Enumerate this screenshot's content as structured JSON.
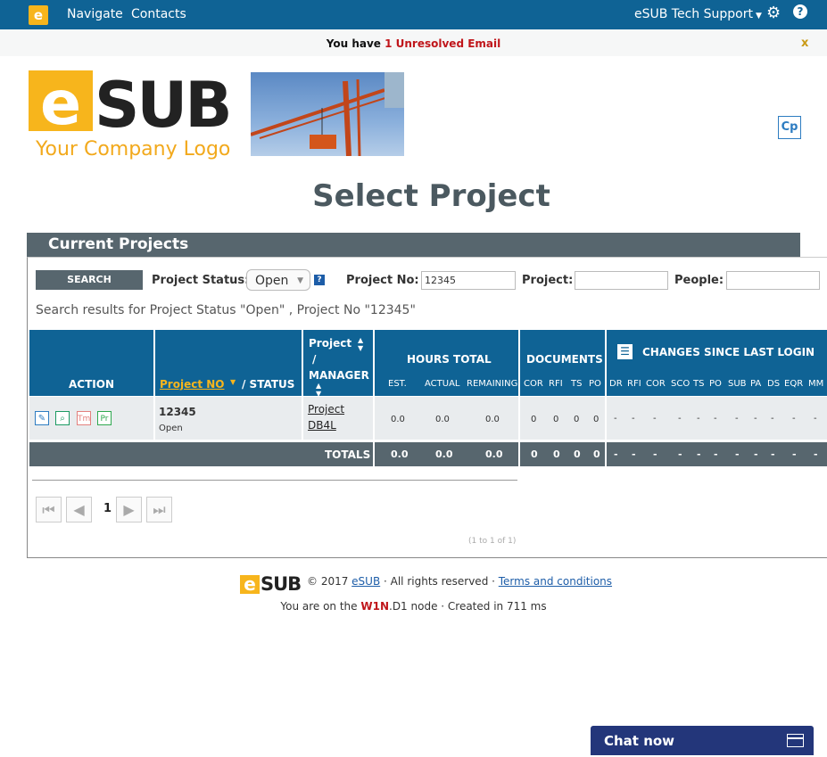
{
  "topbar": {
    "logo_letter": "e",
    "nav": "Navigate",
    "contacts": "Contacts",
    "user": "eSUB Tech Support",
    "help": "?"
  },
  "notice": {
    "prefix": "You have ",
    "count_text": "1 Unresolved Email",
    "close": "x"
  },
  "brand": {
    "logo_text_e": "e",
    "logo_text_sub": "SUB",
    "tagline": "Your Company Logo"
  },
  "cp_label": "Cp",
  "title": "Select Project",
  "panel_title": "Current Projects",
  "search": {
    "button": "SEARCH",
    "status_label": "Project Status:",
    "status_value": "Open",
    "help": "?",
    "project_no_label": "Project No:",
    "project_no_value": "12345",
    "project_label": "Project:",
    "people_label": "People:"
  },
  "results_text": "Search results for Project Status \"Open\" , Project No \"12345\"",
  "grid": {
    "action": "ACTION",
    "project_no": "Project NO",
    "status": "/ STATUS",
    "project": "Project",
    "slash": "/",
    "manager": "MANAGER",
    "hours_total": "HOURS TOTAL",
    "est": "EST.",
    "actual": "ACTUAL",
    "remaining": "REMAINING",
    "documents": "DOCUMENTS",
    "doc_cols": [
      "COR",
      "RFI",
      "TS",
      "PO"
    ],
    "changes": "CHANGES SINCE LAST LOGIN",
    "change_cols": [
      "DR",
      "RFI",
      "COR",
      "SCO",
      "TS",
      "PO",
      "SUB",
      "PA",
      "DS",
      "EQR",
      "MM"
    ]
  },
  "row": {
    "actions": [
      "✎",
      "⌕",
      "Tm",
      "Pr"
    ],
    "number": "12345",
    "status": "Open",
    "project_name_1": "Project",
    "project_name_2": "DB4L",
    "est": "0.0",
    "actual": "0.0",
    "remaining": "0.0",
    "docs": [
      "0",
      "0",
      "0",
      "0"
    ],
    "changes": [
      "-",
      "-",
      "-",
      "-",
      "-",
      "-",
      "-",
      "-",
      "-",
      "-",
      "-"
    ]
  },
  "totals": {
    "label": "TOTALS",
    "est": "0.0",
    "actual": "0.0",
    "remaining": "0.0",
    "docs": [
      "0",
      "0",
      "0",
      "0"
    ],
    "changes": [
      "-",
      "-",
      "-",
      "-",
      "-",
      "-",
      "-",
      "-",
      "-",
      "-",
      "-"
    ]
  },
  "pager": {
    "page": "1",
    "range": "(1 to 1 of 1)"
  },
  "footer": {
    "logo_e": "e",
    "logo_sub": "SUB",
    "copyright": "© 2017 ",
    "company_link": "eSUB",
    "rights": " · All rights reserved · ",
    "terms": "Terms and conditions",
    "node_prefix": "You are on the ",
    "node_bold": "W1N",
    "node_rest": ".D1 node ·  Created in 711 ms"
  },
  "chat": "Chat now",
  "colors": {
    "topbar": "#0f6395",
    "grid_header": "#0f6395",
    "panel_header": "#57666e",
    "accent": "#f7b51c",
    "alert": "#c0161b",
    "chat": "#23367a"
  }
}
